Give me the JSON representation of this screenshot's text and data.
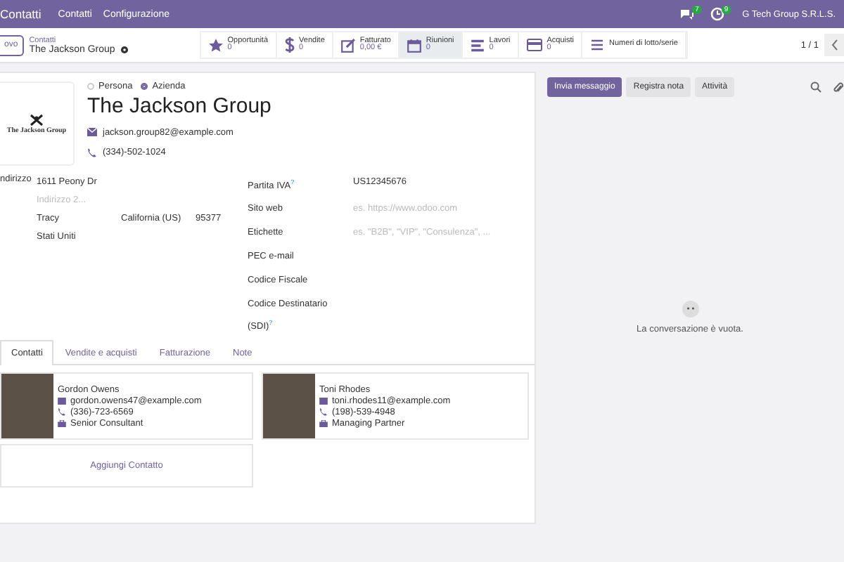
{
  "navbar": {
    "app": "Contatti",
    "menu": [
      "Contatti",
      "Configurazione"
    ],
    "badges": [
      {
        "count": "7"
      },
      {
        "count": "9"
      }
    ],
    "company": "G Tech Group S.R.L.S."
  },
  "control_panel": {
    "new_button": "ovo",
    "breadcrumb": "Contatti",
    "record": "The Jackson Group",
    "pager": "1 / 1"
  },
  "smart_buttons": [
    {
      "label": "Opportunità",
      "value": "0",
      "selected": false
    },
    {
      "label": "Vendite",
      "value": "0",
      "selected": false
    },
    {
      "label": "Fatturato",
      "value": "0,00 €",
      "selected": false
    },
    {
      "label": "Riunioni",
      "value": "0",
      "selected": true
    },
    {
      "label": "Lavori",
      "value": "0",
      "selected": false
    },
    {
      "label": "Acquisti",
      "value": "0",
      "selected": false
    },
    {
      "label": "Numeri di lotto/serie",
      "selected": false
    }
  ],
  "form": {
    "types": [
      {
        "label": "Persona",
        "selected": false
      },
      {
        "label": "Azienda",
        "selected": true
      }
    ],
    "logo": "The Jackson Group",
    "name": "The Jackson Group",
    "email": "jackson.group82@example.com",
    "phone": "(334)-502-1024",
    "address": {
      "label": "ndirizzo",
      "street": "1611 Peony Dr",
      "street2_placeholder": "Indirizzo 2...",
      "city": "Tracy",
      "state": "California (US)",
      "zip": "95377",
      "country": "Stati Uniti"
    },
    "fields": [
      {
        "label": "Partita IVA",
        "help": "?",
        "value": "US12345676"
      },
      {
        "label": "Sito web",
        "placeholder": "es. https://www.odoo.com"
      },
      {
        "label": "Etichette",
        "placeholder": "es. \"B2B\", \"VIP\", \"Consulenza\", ..."
      },
      {
        "label": "PEC e-mail"
      },
      {
        "label": "Codice Fiscale"
      },
      {
        "label": "Codice Destinatario (SDI)",
        "help": "?"
      }
    ]
  },
  "tabs": [
    {
      "label": "Contatti",
      "selected": true
    },
    {
      "label": "Vendite e acquisti",
      "selected": false
    },
    {
      "label": "Fatturazione",
      "selected": false
    },
    {
      "label": "Note",
      "selected": false
    }
  ],
  "contacts": [
    {
      "name": "Gordon Owens",
      "email": "gordon.owens47@example.com",
      "phone": "(336)-723-6569",
      "function": "Senior Consultant"
    },
    {
      "name": "Toni Rhodes",
      "email": "toni.rhodes11@example.com",
      "phone": "(198)-539-4948",
      "function": "Managing Partner"
    }
  ],
  "add_contact": "Aggiungi Contatto",
  "chatter": {
    "buttons": [
      {
        "label": "Invia messaggio",
        "selected": true
      },
      {
        "label": "Registra nota",
        "selected": false
      },
      {
        "label": "Attività",
        "selected": false
      }
    ],
    "empty": "La conversazione è vuota."
  }
}
